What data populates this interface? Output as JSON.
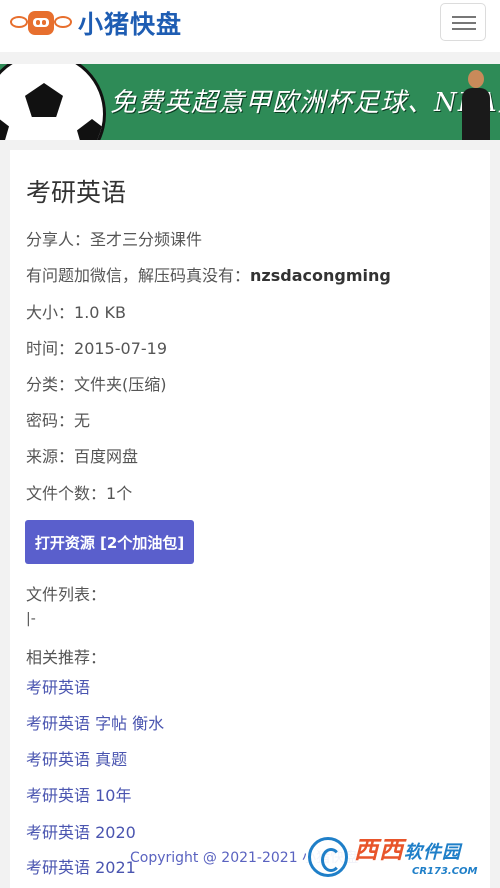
{
  "header": {
    "logo_text": "小猪快盘",
    "menu_icon": "hamburger-menu-icon"
  },
  "banner": {
    "text": "免费英超意甲欧洲杯足球、NBA篮球"
  },
  "file": {
    "title": "考研英语",
    "sharer_label": "分享人：",
    "sharer": "圣才三分频课件",
    "notice_label": "有问题加微信，解压码真没有：",
    "notice_value": "nzsdacongming",
    "size_label": "大小：",
    "size": "1.0 KB",
    "time_label": "时间：",
    "time": "2015-07-19",
    "category_label": "分类：",
    "category": "文件夹(压缩)",
    "password_label": "密码：",
    "password": "无",
    "source_label": "来源：",
    "source": "百度网盘",
    "count_label": "文件个数：",
    "count": "1个",
    "open_button": "打开资源 [2个加油包]",
    "file_list_label": "文件列表：",
    "file_list_item": "|-",
    "related_label": "相关推荐："
  },
  "related": [
    "考研英语",
    "考研英语 字帖 衡水",
    "考研英语 真题",
    "考研英语 10年",
    "考研英语 2020",
    "考研英语 2021"
  ],
  "footer": {
    "copyright": "Copyright @ 2021-2021 小猪快盘"
  },
  "watermark": {
    "main": "西西",
    "main_suffix": "软件园",
    "sub": "CR173.COM"
  },
  "colors": {
    "brand_blue": "#1e5db3",
    "button": "#5a5fcc",
    "link": "#4a55b0",
    "banner_green": "#2e8b57",
    "logo_orange": "#e76f2e"
  }
}
